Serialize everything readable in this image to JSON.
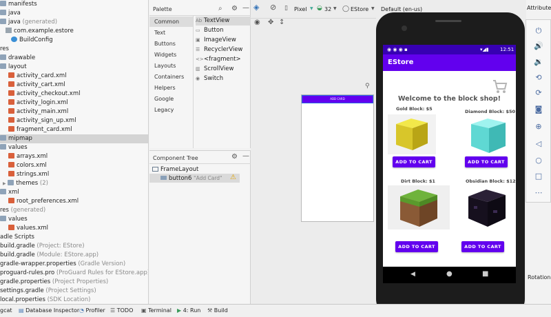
{
  "project_tree": {
    "rows": [
      {
        "label": "manifests",
        "icon": "folder-icon",
        "indent": 0
      },
      {
        "label": "java",
        "icon": "folder-icon",
        "indent": 0
      },
      {
        "label": "java",
        "suffix": " (generated)",
        "icon": "folder-icon",
        "indent": 0
      },
      {
        "label": "com.example.estore",
        "icon": "package-icon",
        "indent": 1
      },
      {
        "label": "BuildConfig",
        "icon": "class-icon",
        "indent": 2
      },
      {
        "label": "res",
        "icon": "folder-icon",
        "indent": 0
      },
      {
        "label": "drawable",
        "icon": "folder-icon",
        "indent": 1
      },
      {
        "label": "layout",
        "icon": "folder-icon",
        "indent": 1
      },
      {
        "label": "activity_card.xml",
        "icon": "xml-icon",
        "indent": 2
      },
      {
        "label": "activity_cart.xml",
        "icon": "xml-icon",
        "indent": 2
      },
      {
        "label": "activity_checkout.xml",
        "icon": "xml-icon",
        "indent": 2
      },
      {
        "label": "activity_login.xml",
        "icon": "xml-icon",
        "indent": 2
      },
      {
        "label": "activity_main.xml",
        "icon": "xml-icon",
        "indent": 2
      },
      {
        "label": "activity_sign_up.xml",
        "icon": "xml-icon",
        "indent": 2
      },
      {
        "label": "fragment_card.xml",
        "icon": "xml-icon",
        "indent": 2
      },
      {
        "label": "mipmap",
        "icon": "folder-icon",
        "indent": 1,
        "selected": true
      },
      {
        "label": "values",
        "icon": "folder-icon",
        "indent": 1
      },
      {
        "label": "arrays.xml",
        "icon": "xml-icon",
        "indent": 2
      },
      {
        "label": "colors.xml",
        "icon": "xml-icon",
        "indent": 2
      },
      {
        "label": "strings.xml",
        "icon": "xml-icon",
        "indent": 2
      },
      {
        "label": "themes",
        "suffix": " (2)",
        "icon": "folder-icon",
        "indent": 2
      },
      {
        "label": "xml",
        "icon": "folder-icon",
        "indent": 1
      },
      {
        "label": "root_preferences.xml",
        "icon": "xml-icon",
        "indent": 2
      },
      {
        "label": "res",
        "suffix": " (generated)",
        "icon": "folder-icon",
        "indent": 0
      },
      {
        "label": "values",
        "icon": "folder-icon",
        "indent": 1
      },
      {
        "label": "values.xml",
        "icon": "xml-icon",
        "indent": 2
      },
      {
        "label": "adle Scripts",
        "icon": "",
        "indent": 0
      },
      {
        "label": "build.gradle",
        "suffix": " (Project: EStore)",
        "icon": "",
        "indent": 0
      },
      {
        "label": "build.gradle",
        "suffix": " (Module: EStore.app)",
        "icon": "",
        "indent": 0
      },
      {
        "label": "gradle-wrapper.properties",
        "suffix": " (Gradle Version)",
        "icon": "",
        "indent": 0
      },
      {
        "label": "proguard-rules.pro",
        "suffix": " (ProGuard Rules for EStore.app)",
        "icon": "",
        "indent": 0
      },
      {
        "label": "gradle.properties",
        "suffix": " (Project Properties)",
        "icon": "",
        "indent": 0
      },
      {
        "label": "settings.gradle",
        "suffix": " (Project Settings)",
        "icon": "",
        "indent": 0
      },
      {
        "label": "local.properties",
        "suffix": " (SDK Location)",
        "icon": "",
        "indent": 0
      }
    ]
  },
  "palette": {
    "title": "Palette",
    "categories": [
      "Common",
      "Text",
      "Buttons",
      "Widgets",
      "Layouts",
      "Containers",
      "Helpers",
      "Google",
      "Legacy"
    ],
    "items": [
      {
        "icon_text": "Ab",
        "label": "TextView"
      },
      {
        "icon_text": "▭",
        "label": "Button"
      },
      {
        "icon_text": "▣",
        "label": "ImageView"
      },
      {
        "icon_text": "☰",
        "label": "RecyclerView"
      },
      {
        "icon_text": "<>",
        "label": "<fragment>"
      },
      {
        "icon_text": "▥",
        "label": "ScrollView"
      },
      {
        "icon_text": "◉",
        "label": "Switch"
      }
    ]
  },
  "component_tree": {
    "title": "Component Tree",
    "root": "FrameLayout",
    "child": "button6",
    "child_text": "\"Add Card\""
  },
  "design_toolbar": {
    "device": "Pixel",
    "api": "32",
    "theme": "EStore",
    "locale": "Default (en-us)",
    "attributes": "Attributes"
  },
  "canvas": {
    "button_text": "ADD CARD"
  },
  "phone": {
    "status_time": "12:51",
    "app_title": "EStore",
    "welcome": "Welcome to the block shop!",
    "products": [
      {
        "name": "Gold Block: $5",
        "button": "ADD TO CART"
      },
      {
        "name": "Diamond Block: $50",
        "button": "ADD TO CART"
      },
      {
        "name": "Dirt Block: $1",
        "button": "ADD TO CART"
      },
      {
        "name": "Obsidian Block: $12",
        "button": "ADD TO CART"
      }
    ]
  },
  "emulator": {
    "rotation_label": "Rotation"
  },
  "bottom_bar": {
    "items": [
      "gcat",
      "Database Inspector",
      "Profiler",
      "TODO",
      "Terminal",
      "4: Run",
      "Build"
    ]
  },
  "colors": {
    "accent": "#6200ee",
    "status_bar": "#3700b3"
  }
}
